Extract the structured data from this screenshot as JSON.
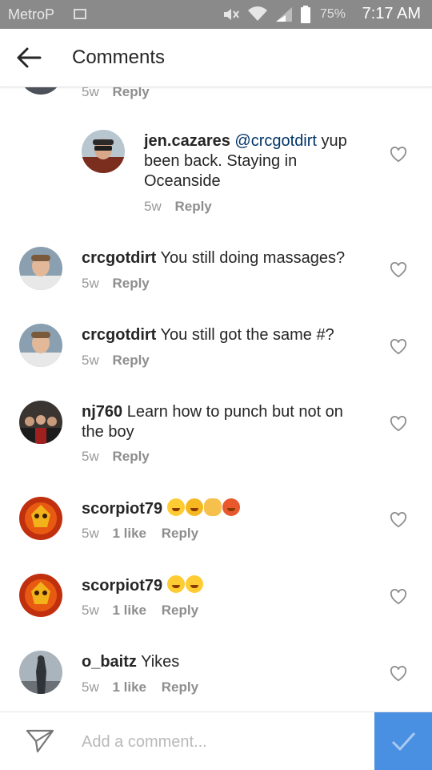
{
  "status_bar": {
    "carrier": "MetroP",
    "battery": "75%",
    "time": "7:17 AM"
  },
  "header": {
    "title": "Comments"
  },
  "partial": {
    "time": "5w",
    "reply": "Reply"
  },
  "comments": [
    {
      "username": "jen.cazares",
      "mention": "@crcgotdirt",
      "text": "yup been back. Staying in Oceanside",
      "time": "5w",
      "likes": "",
      "reply": "Reply"
    },
    {
      "username": "crcgotdirt",
      "text": "You still doing massages?",
      "time": "5w",
      "likes": "",
      "reply": "Reply"
    },
    {
      "username": "crcgotdirt",
      "text": "You still got the same #?",
      "time": "5w",
      "likes": "",
      "reply": "Reply"
    },
    {
      "username": "nj760",
      "text": "Learn how to punch but not on the boy",
      "time": "5w",
      "likes": "",
      "reply": "Reply"
    },
    {
      "username": "scorpiot79",
      "text": "",
      "emojis": [
        "scream-emoji",
        "angry-emoji",
        "fist-emoji",
        "devil-emoji"
      ],
      "time": "5w",
      "likes": "1 like",
      "reply": "Reply"
    },
    {
      "username": "scorpiot79",
      "text": "",
      "emojis": [
        "tongue-emoji",
        "laughing-emoji"
      ],
      "time": "5w",
      "likes": "1 like",
      "reply": "Reply"
    },
    {
      "username": "o_baitz",
      "text": "Yikes",
      "time": "5w",
      "likes": "1 like",
      "reply": "Reply"
    }
  ],
  "footer": {
    "placeholder": "Add a comment..."
  },
  "colors": {
    "accent": "#4a90e2",
    "mention": "#003569",
    "status_bar": "#8a8a8a"
  }
}
